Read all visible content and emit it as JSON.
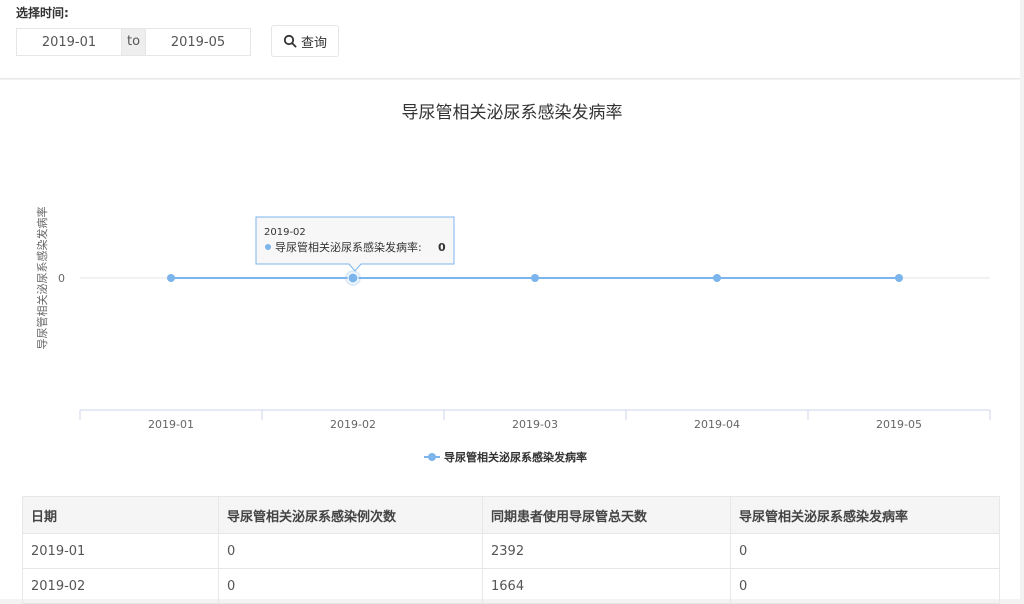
{
  "filter": {
    "label": "选择时间:",
    "start_value": "2019-01",
    "to_label": "to",
    "end_value": "2019-05",
    "query_label": "查询"
  },
  "chart_data": {
    "type": "line",
    "title": "导尿管相关泌尿系感染发病率",
    "ylabel": "导尿管相关泌尿系感染发病率",
    "xlabel": "",
    "categories": [
      "2019-01",
      "2019-02",
      "2019-03",
      "2019-04",
      "2019-05"
    ],
    "series": [
      {
        "name": "导尿管相关泌尿系感染发病率",
        "values": [
          0,
          0,
          0,
          0,
          0
        ],
        "color": "#7cb5ec"
      }
    ],
    "y_ticks": [
      "0"
    ],
    "grid": true,
    "legend": "bottom-center",
    "tooltip": {
      "category": "2019-02",
      "series_label": "导尿管相关泌尿系感染发病率:",
      "value": "0"
    }
  },
  "table": {
    "headers": [
      "日期",
      "导尿管相关泌尿系感染例次数",
      "同期患者使用导尿管总天数",
      "导尿管相关泌尿系感染发病率"
    ],
    "rows": [
      [
        "2019-01",
        "0",
        "2392",
        "0"
      ],
      [
        "2019-02",
        "0",
        "1664",
        "0"
      ]
    ]
  },
  "colors": {
    "series": "#7cb5ec",
    "background": "#f3f3f4"
  }
}
